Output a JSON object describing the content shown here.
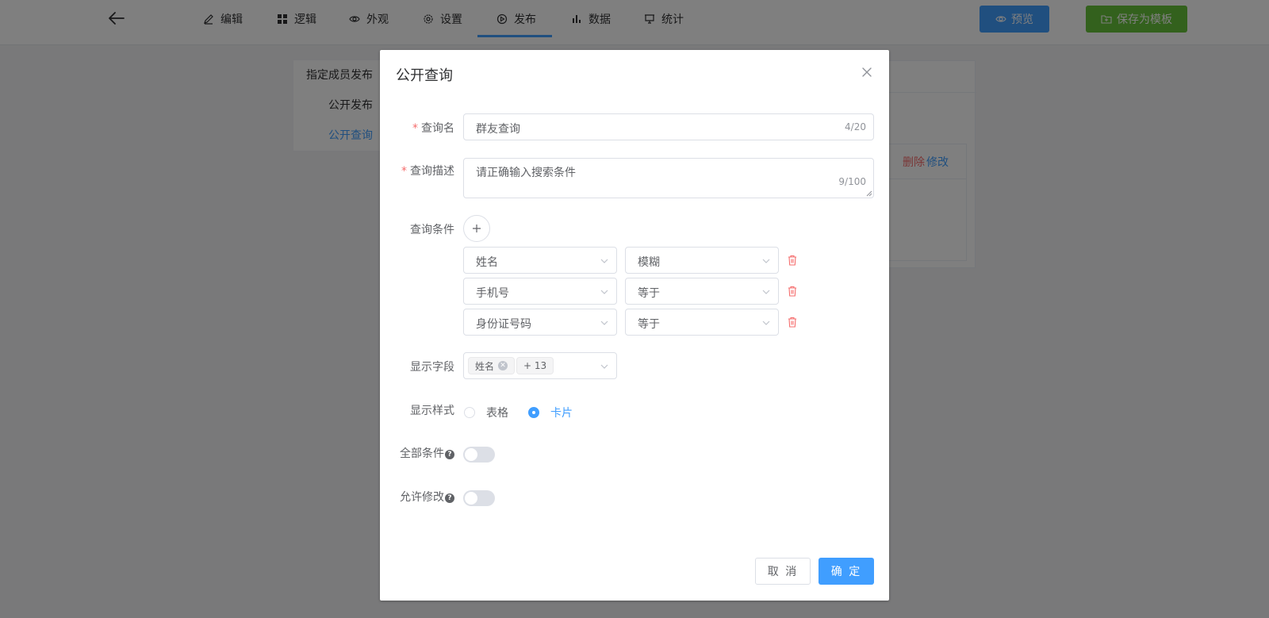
{
  "nav": {
    "tabs": [
      {
        "label": "编辑",
        "icon": "pencil-icon"
      },
      {
        "label": "逻辑",
        "icon": "grid-icon"
      },
      {
        "label": "外观",
        "icon": "eye-icon"
      },
      {
        "label": "设置",
        "icon": "gear-icon"
      },
      {
        "label": "发布",
        "icon": "play-circle-icon"
      },
      {
        "label": "数据",
        "icon": "bar-chart-icon"
      },
      {
        "label": "统计",
        "icon": "presentation-icon"
      }
    ],
    "active_tab": "发布",
    "preview_label": "预览",
    "save_template_label": "保存为模板"
  },
  "side_menu": {
    "items": [
      "指定成员发布",
      "公开发布",
      "公开查询"
    ],
    "active": "公开查询"
  },
  "content": {
    "delete_label": "删除",
    "edit_label": "修改"
  },
  "dialog": {
    "title": "公开查询",
    "query_name": {
      "label": "查询名",
      "value": "群友查询",
      "count": "4/20"
    },
    "query_desc": {
      "label": "查询描述",
      "value": "请正确输入搜索条件",
      "count": "9/100"
    },
    "conditions": {
      "label": "查询条件",
      "rows": [
        {
          "field": "姓名",
          "op": "模糊"
        },
        {
          "field": "手机号",
          "op": "等于"
        },
        {
          "field": "身份证号码",
          "op": "等于"
        }
      ]
    },
    "display_fields": {
      "label": "显示字段",
      "tag": "姓名",
      "more": "+ 13"
    },
    "display_style": {
      "label": "显示样式",
      "options": [
        "表格",
        "卡片"
      ],
      "selected": "卡片"
    },
    "all_conditions": {
      "label": "全部条件",
      "on": false
    },
    "allow_edit": {
      "label": "允许修改",
      "on": false
    },
    "cancel_label": "取 消",
    "ok_label": "确 定"
  },
  "colors": {
    "primary": "#409eff",
    "danger": "#f56c6c",
    "success": "#67c23a"
  }
}
